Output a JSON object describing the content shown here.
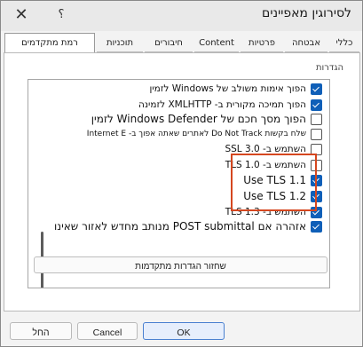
{
  "window": {
    "title": "לסירוגין מאפיינים",
    "help_label": "؟",
    "close_label": "✕"
  },
  "tabs": [
    {
      "label": "כללי",
      "active": false
    },
    {
      "label": "אבטחה",
      "active": false
    },
    {
      "label": "פרטיות",
      "active": false
    },
    {
      "label": "Content",
      "active": false
    },
    {
      "label": "חיבורים",
      "active": false
    },
    {
      "label": "תוכניות",
      "active": false
    },
    {
      "label": "רמת מתקדמים",
      "active": true
    }
  ],
  "settings": {
    "section_label": "הגדרות",
    "items": [
      {
        "label": "הפוך אימות משולב של Windows לזמין",
        "checked": true
      },
      {
        "label": "הפוך תמיכה מקורית ב- XMLHTTP לזמינה",
        "checked": true
      },
      {
        "label": "הפוך מסך חכם של Windows Defender לזמין",
        "checked": false
      },
      {
        "label": "שלח בקשות Do Not Track לאתרים שאתה אפוך ב- Internet E",
        "checked": false
      },
      {
        "label": "השתמש ב- SSL 3.0",
        "checked": false
      },
      {
        "label": "השתמש ב- TLS 1.0",
        "checked": false
      },
      {
        "label": "Use TLS 1.1",
        "checked": true
      },
      {
        "label": "Use TLS 1.2",
        "checked": true
      },
      {
        "label": "השתמש ב- TLS 1.3",
        "checked": true
      },
      {
        "label": "אזהרה אם POST submittal מנותב מחדש לאזור שאינו",
        "checked": true
      }
    ]
  },
  "restore_button": "שחזור הגדרות מתקדמות",
  "footer": {
    "ok": "OK",
    "cancel": "Cancel",
    "apply": "החל"
  },
  "colors": {
    "accent": "#0f5fb8",
    "highlight_border": "#d5471f"
  }
}
